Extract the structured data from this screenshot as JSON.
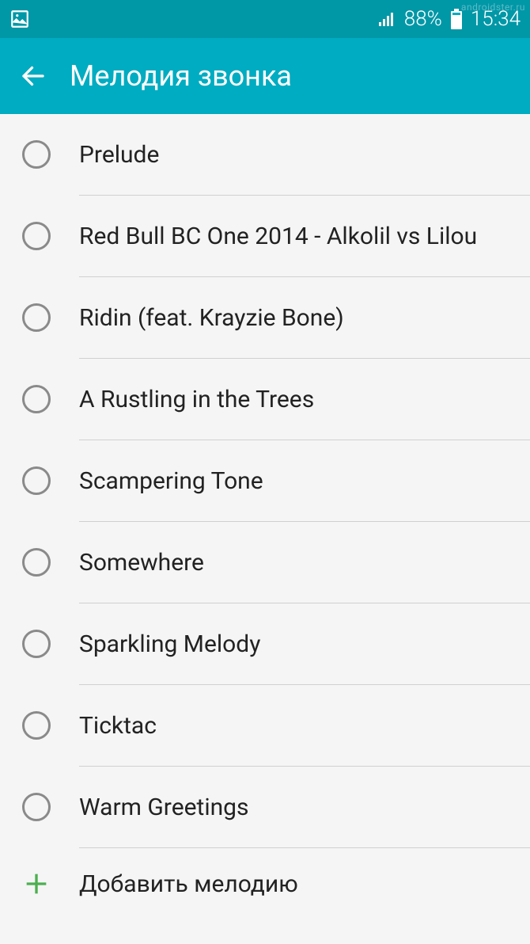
{
  "statusBar": {
    "battery": "88%",
    "time": "15:34",
    "watermark": "androidster.ru"
  },
  "header": {
    "title": "Мелодия звонка"
  },
  "ringtones": [
    {
      "label": "Prelude"
    },
    {
      "label": "Red Bull BC One 2014 - Alkolil vs Lilou"
    },
    {
      "label": "Ridin (feat. Krayzie Bone)"
    },
    {
      "label": "A Rustling in the Trees"
    },
    {
      "label": "Scampering Tone"
    },
    {
      "label": "Somewhere"
    },
    {
      "label": "Sparkling Melody"
    },
    {
      "label": "Ticktac"
    },
    {
      "label": "Warm Greetings"
    }
  ],
  "addAction": {
    "label": "Добавить мелодию"
  }
}
